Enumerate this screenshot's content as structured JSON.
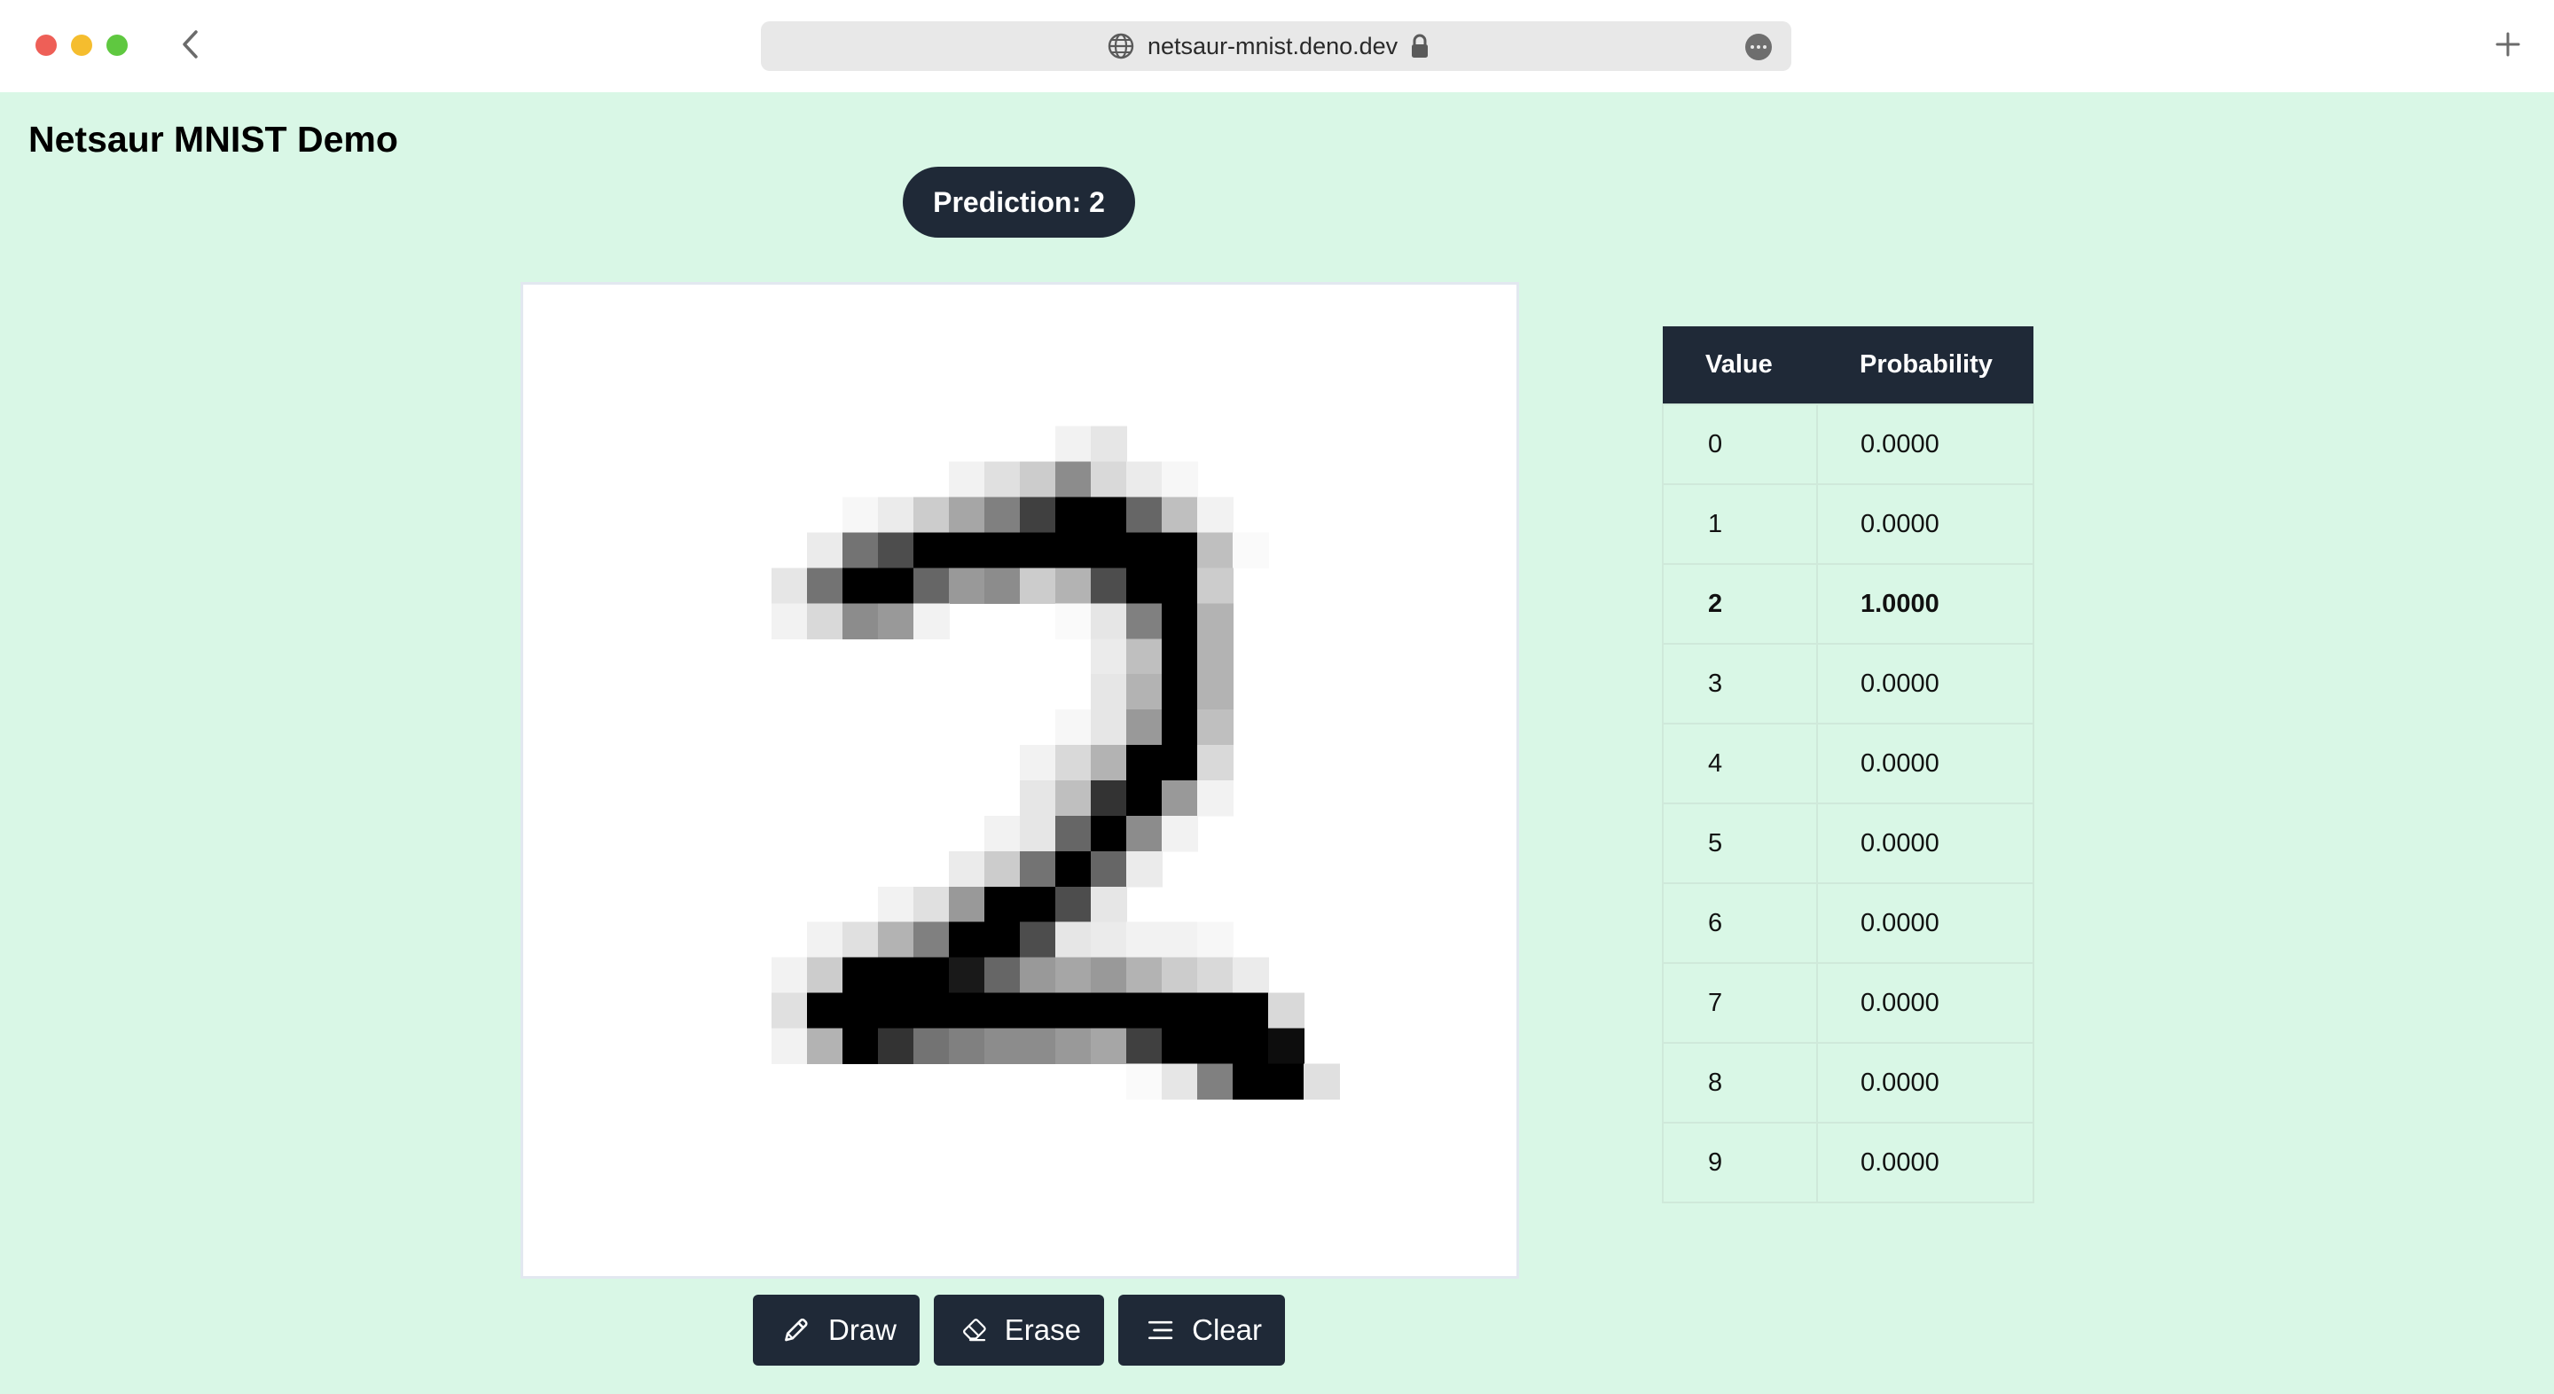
{
  "browser": {
    "url": "netsaur-mnist.deno.dev"
  },
  "page": {
    "title": "Netsaur MNIST Demo",
    "prediction_label": "Prediction: 2"
  },
  "toolbar": {
    "draw_label": "Draw",
    "erase_label": "Erase",
    "clear_label": "Clear"
  },
  "table": {
    "headers": [
      "Value",
      "Probability"
    ],
    "rows": [
      {
        "value": "0",
        "probability": "0.0000"
      },
      {
        "value": "1",
        "probability": "0.0000"
      },
      {
        "value": "2",
        "probability": "1.0000"
      },
      {
        "value": "3",
        "probability": "0.0000"
      },
      {
        "value": "4",
        "probability": "0.0000"
      },
      {
        "value": "5",
        "probability": "0.0000"
      },
      {
        "value": "6",
        "probability": "0.0000"
      },
      {
        "value": "7",
        "probability": "0.0000"
      },
      {
        "value": "8",
        "probability": "0.0000"
      },
      {
        "value": "9",
        "probability": "0.0000"
      }
    ],
    "highlighted_row": 2
  },
  "drawing": {
    "grid_size": 28,
    "pixels": [
      [
        0,
        0,
        0,
        0,
        0,
        0,
        0,
        0,
        0,
        0,
        0,
        0,
        0,
        0,
        0,
        0,
        0,
        0,
        0,
        0,
        0,
        0,
        0,
        0,
        0,
        0,
        0,
        0
      ],
      [
        0,
        0,
        0,
        0,
        0,
        0,
        0,
        0,
        0,
        0,
        0,
        0,
        0,
        0,
        0,
        0,
        0,
        0,
        0,
        0,
        0,
        0,
        0,
        0,
        0,
        0,
        0,
        0
      ],
      [
        0,
        0,
        0,
        0,
        0,
        0,
        0,
        0,
        0,
        0,
        0,
        0,
        0,
        0,
        0,
        0,
        0,
        0,
        0,
        0,
        0,
        0,
        0,
        0,
        0,
        0,
        0,
        0
      ],
      [
        0,
        0,
        0,
        0,
        0,
        0,
        0,
        0,
        0,
        0,
        0,
        0,
        0,
        0,
        0,
        0,
        0,
        0,
        0,
        0,
        0,
        0,
        0,
        0,
        0,
        0,
        0,
        0
      ],
      [
        0,
        0,
        0,
        0,
        0,
        0,
        0,
        0,
        0,
        0,
        0,
        0,
        0,
        0,
        0,
        0.05,
        0.1,
        0,
        0,
        0,
        0,
        0,
        0,
        0,
        0,
        0,
        0,
        0
      ],
      [
        0,
        0,
        0,
        0,
        0,
        0,
        0,
        0,
        0,
        0,
        0,
        0,
        0.05,
        0.12,
        0.2,
        0.45,
        0.15,
        0.08,
        0.03,
        0,
        0,
        0,
        0,
        0,
        0,
        0,
        0,
        0
      ],
      [
        0,
        0,
        0,
        0,
        0,
        0,
        0,
        0,
        0,
        0.03,
        0.08,
        0.2,
        0.35,
        0.5,
        0.75,
        1,
        1,
        0.6,
        0.25,
        0.05,
        0,
        0,
        0,
        0,
        0,
        0,
        0,
        0
      ],
      [
        0,
        0,
        0,
        0,
        0,
        0,
        0,
        0,
        0.08,
        0.55,
        0.7,
        1,
        1,
        1,
        1,
        1,
        1,
        1,
        1,
        0.25,
        0.02,
        0,
        0,
        0,
        0,
        0,
        0,
        0
      ],
      [
        0,
        0,
        0,
        0,
        0,
        0,
        0,
        0.1,
        0.55,
        1,
        1,
        0.6,
        0.4,
        0.45,
        0.2,
        0.3,
        0.7,
        1,
        1,
        0.2,
        0,
        0,
        0,
        0,
        0,
        0,
        0,
        0
      ],
      [
        0,
        0,
        0,
        0,
        0,
        0,
        0,
        0.05,
        0.15,
        0.45,
        0.4,
        0.05,
        0,
        0,
        0,
        0.02,
        0.1,
        0.5,
        1,
        0.3,
        0,
        0,
        0,
        0,
        0,
        0,
        0,
        0
      ],
      [
        0,
        0,
        0,
        0,
        0,
        0,
        0,
        0,
        0,
        0,
        0,
        0,
        0,
        0,
        0,
        0,
        0.08,
        0.25,
        1,
        0.3,
        0,
        0,
        0,
        0,
        0,
        0,
        0,
        0
      ],
      [
        0,
        0,
        0,
        0,
        0,
        0,
        0,
        0,
        0,
        0,
        0,
        0,
        0,
        0,
        0,
        0,
        0.1,
        0.3,
        1,
        0.3,
        0,
        0,
        0,
        0,
        0,
        0,
        0,
        0
      ],
      [
        0,
        0,
        0,
        0,
        0,
        0,
        0,
        0,
        0,
        0,
        0,
        0,
        0,
        0,
        0,
        0.03,
        0.1,
        0.4,
        1,
        0.25,
        0,
        0,
        0,
        0,
        0,
        0,
        0,
        0
      ],
      [
        0,
        0,
        0,
        0,
        0,
        0,
        0,
        0,
        0,
        0,
        0,
        0,
        0,
        0,
        0.05,
        0.15,
        0.3,
        1,
        1,
        0.15,
        0,
        0,
        0,
        0,
        0,
        0,
        0,
        0
      ],
      [
        0,
        0,
        0,
        0,
        0,
        0,
        0,
        0,
        0,
        0,
        0,
        0,
        0,
        0,
        0.1,
        0.25,
        0.8,
        1,
        0.4,
        0.05,
        0,
        0,
        0,
        0,
        0,
        0,
        0,
        0
      ],
      [
        0,
        0,
        0,
        0,
        0,
        0,
        0,
        0,
        0,
        0,
        0,
        0,
        0,
        0.05,
        0.1,
        0.6,
        1,
        0.45,
        0.05,
        0,
        0,
        0,
        0,
        0,
        0,
        0,
        0,
        0
      ],
      [
        0,
        0,
        0,
        0,
        0,
        0,
        0,
        0,
        0,
        0,
        0,
        0,
        0.08,
        0.2,
        0.55,
        1,
        0.6,
        0.08,
        0,
        0,
        0,
        0,
        0,
        0,
        0,
        0,
        0,
        0
      ],
      [
        0,
        0,
        0,
        0,
        0,
        0,
        0,
        0,
        0,
        0,
        0.05,
        0.12,
        0.4,
        1,
        1,
        0.7,
        0.1,
        0,
        0,
        0,
        0,
        0,
        0,
        0,
        0,
        0,
        0,
        0
      ],
      [
        0,
        0,
        0,
        0,
        0,
        0,
        0,
        0,
        0.05,
        0.12,
        0.3,
        0.5,
        1,
        1,
        0.7,
        0.1,
        0.08,
        0.05,
        0.05,
        0.03,
        0,
        0,
        0,
        0,
        0,
        0,
        0,
        0
      ],
      [
        0,
        0,
        0,
        0,
        0,
        0,
        0,
        0.05,
        0.2,
        1,
        1,
        1,
        0.9,
        0.6,
        0.4,
        0.35,
        0.4,
        0.3,
        0.2,
        0.15,
        0.08,
        0,
        0,
        0,
        0,
        0,
        0,
        0
      ],
      [
        0,
        0,
        0,
        0,
        0,
        0,
        0,
        0.12,
        1,
        1,
        1,
        1,
        1,
        1,
        1,
        1,
        1,
        1,
        1,
        1,
        1,
        0.15,
        0,
        0,
        0,
        0,
        0,
        0
      ],
      [
        0,
        0,
        0,
        0,
        0,
        0,
        0,
        0.05,
        0.3,
        1,
        0.8,
        0.55,
        0.5,
        0.45,
        0.45,
        0.4,
        0.35,
        0.75,
        1,
        1,
        1,
        0.95,
        0,
        0,
        0,
        0,
        0,
        0
      ],
      [
        0,
        0,
        0,
        0,
        0,
        0,
        0,
        0,
        0,
        0,
        0,
        0,
        0,
        0,
        0,
        0,
        0,
        0.02,
        0.1,
        0.5,
        1,
        1,
        0.12,
        0,
        0,
        0,
        0,
        0
      ],
      [
        0,
        0,
        0,
        0,
        0,
        0,
        0,
        0,
        0,
        0,
        0,
        0,
        0,
        0,
        0,
        0,
        0,
        0,
        0,
        0,
        0,
        0,
        0,
        0,
        0,
        0,
        0,
        0
      ],
      [
        0,
        0,
        0,
        0,
        0,
        0,
        0,
        0,
        0,
        0,
        0,
        0,
        0,
        0,
        0,
        0,
        0,
        0,
        0,
        0,
        0,
        0,
        0,
        0,
        0,
        0,
        0,
        0
      ],
      [
        0,
        0,
        0,
        0,
        0,
        0,
        0,
        0,
        0,
        0,
        0,
        0,
        0,
        0,
        0,
        0,
        0,
        0,
        0,
        0,
        0,
        0,
        0,
        0,
        0,
        0,
        0,
        0
      ],
      [
        0,
        0,
        0,
        0,
        0,
        0,
        0,
        0,
        0,
        0,
        0,
        0,
        0,
        0,
        0,
        0,
        0,
        0,
        0,
        0,
        0,
        0,
        0,
        0,
        0,
        0,
        0,
        0
      ],
      [
        0,
        0,
        0,
        0,
        0,
        0,
        0,
        0,
        0,
        0,
        0,
        0,
        0,
        0,
        0,
        0,
        0,
        0,
        0,
        0,
        0,
        0,
        0,
        0,
        0,
        0,
        0,
        0
      ]
    ]
  },
  "colors": {
    "page_background": "#d9f7e6",
    "dark": "#1f2937"
  },
  "icons": {
    "draw": "pencil-icon",
    "erase": "eraser-icon",
    "clear": "clear-lines-icon"
  }
}
